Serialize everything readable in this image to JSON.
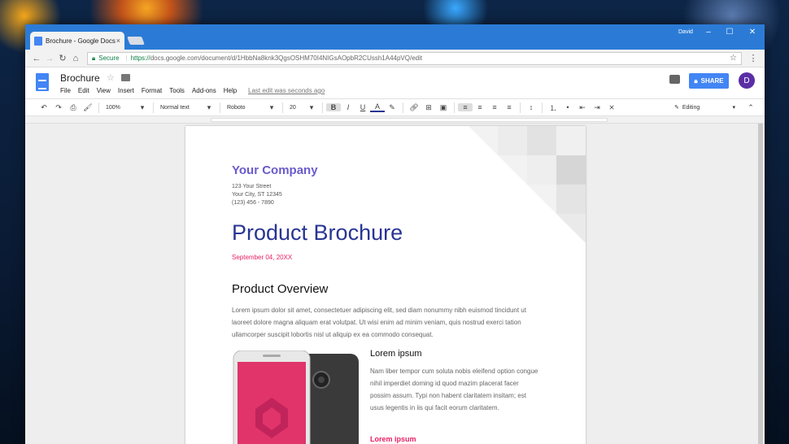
{
  "browser": {
    "tab_title": "Brochure - Google Docs",
    "tab_close": "×",
    "user_name": "David",
    "win_min": "–",
    "win_max": "☐",
    "win_close": "✕",
    "secure_label": "Secure",
    "url_scheme": "https://",
    "url_rest": "docs.google.com/document/d/1HbbNa8knk3QgsOSHM70I4NIGsAOpbR2CUssh1A44pVQ/edit"
  },
  "docs": {
    "title": "Brochure",
    "menus": [
      "File",
      "Edit",
      "View",
      "Insert",
      "Format",
      "Tools",
      "Add-ons",
      "Help"
    ],
    "last_edit": "Last edit was seconds ago",
    "share_label": "SHARE",
    "avatar_initial": "D"
  },
  "toolbar": {
    "zoom": "100%",
    "style": "Normal text",
    "font": "Roboto",
    "size": "20",
    "mode": "Editing"
  },
  "document": {
    "company": "Your Company",
    "address": [
      "123 Your Street",
      "Your City, ST 12345",
      "(123) 456 - 7890"
    ],
    "title": "Product Brochure",
    "date": "September 04, 20XX",
    "section_heading": "Product Overview",
    "section_text": "Lorem ipsum dolor sit amet, consectetuer adipiscing elit, sed diam nonummy nibh euismod tincidunt ut laoreet dolore magna aliquam erat volutpat. Ut wisi enim ad minim veniam, quis nostrud exerci tation ullamcorper suscipit lobortis nisl ut aliquip ex ea commodo consequat.",
    "sub_heading": "Lorem ipsum",
    "sub_text": "Nam liber tempor cum soluta nobis eleifend option congue nihil imperdiet doming id quod mazim placerat facer possim assum. Typi non habent claritatem insitam; est usus legentis in iis qui facit eorum claritatem.",
    "sub_heading_2": "Lorem ipsum"
  },
  "colors": {
    "chrome_blue": "#2b7bd6",
    "company": "#6a5acd",
    "title": "#283593",
    "accent": "#e91e63"
  }
}
